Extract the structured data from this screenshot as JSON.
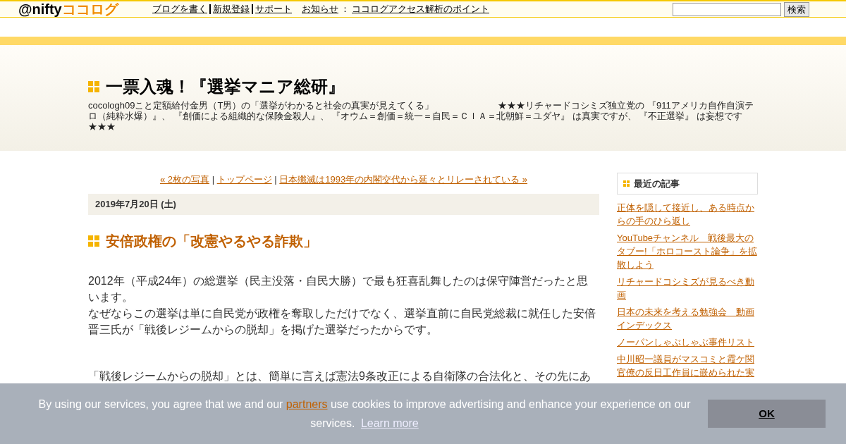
{
  "topbar": {
    "logo_prefix": "@nifty",
    "logo_name": "ココログ",
    "links": [
      {
        "label": "ブログを書く"
      },
      {
        "label": "新規登録"
      },
      {
        "label": "サポート"
      }
    ],
    "notice_label": "お知らせ",
    "notice_separator": "：",
    "notice_link": "ココログアクセス解析のポイント",
    "search_button": "検索"
  },
  "blog": {
    "title": "一票入魂！『選挙マニア総研』",
    "description": "cocologh09こと定額給付金男（T男）の「選挙がわかると社会の真実が見えてくる」　　　　　　　★★★リチャードコシミズ独立党の 『911アメリカ自作自演テロ（純粋水爆）』、 『創価による組織的な保険金殺人』、 『オウム＝創価＝統一＝自民＝ＣＩＡ＝北朝鮮＝ユダヤ』 は真実ですが、 『不正選挙』 は妄想です★★★"
  },
  "nav": {
    "prev": "« 2枚の写真",
    "separator": "|",
    "home": "トップページ",
    "next": "日本殲滅は1993年の内閣交代から延々とリレーされている »"
  },
  "post": {
    "date": "2019年7月20日 (土)",
    "title": "安倍政権の「改憲やるやる詐欺」",
    "paragraphs": [
      [
        "2012年（平成24年）の総選挙（民主没落・自民大勝）で最も狂喜乱舞したのは保守陣営だったと思います。",
        "なぜならこの選挙は単に自民党が政権を奪取しただけでなく、選挙直前に自民党総裁に就任した安倍晋三氏が「戦後レジームからの脱却」を掲げた選挙だったからです。"
      ],
      [
        "「戦後レジームからの脱却」とは、簡単に言えば憲法9条改正による自衛隊の合法化と、その先にあ"
      ]
    ]
  },
  "sidebar": {
    "heading": "最近の記事",
    "items": [
      {
        "label": "正体を隠して接近し、ある時点からの手のひら返し"
      },
      {
        "label": "YouTubeチャンネル　戦後最大のタブー!「ホロコースト論争」を拡散しよう"
      },
      {
        "label": "リチャードコシミズが見るべき動画"
      },
      {
        "label": "日本の未来を考える勉強会　動画インデックス"
      },
      {
        "label": "ノーパンしゃぶしゃぶ事件リスト"
      },
      {
        "label": "中川昭一議員がマスコミと霞ケ関官僚の反日工作員に嵌められた実"
      }
    ]
  },
  "cookie": {
    "text_before": "By using our services, you agree that we and our",
    "partners": "partners",
    "text_after": "use cookies to improve advertising and enhance your experience on our services.",
    "learn_more": "Learn more",
    "ok": "OK"
  }
}
